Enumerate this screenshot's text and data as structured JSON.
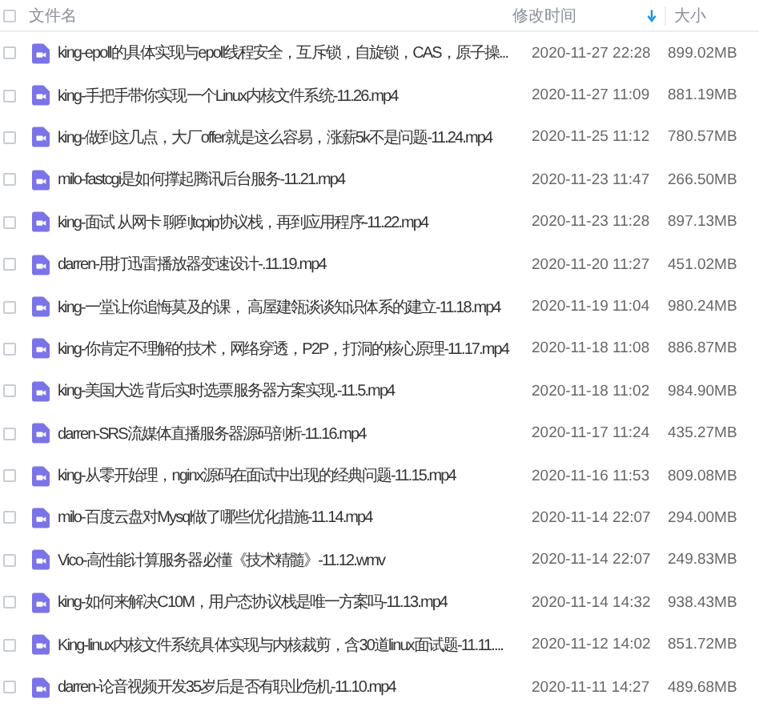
{
  "table": {
    "select_all": {
      "checked": false
    },
    "columns": [
      {
        "label": "文件名"
      },
      {
        "label": "修改时间",
        "sorted_descending": true
      },
      {
        "label": "大小"
      }
    ],
    "rows": [
      {
        "checked": false,
        "name": "king-epoll的具体实现与epoll线程安全，互斥锁，自旋锁，CAS，原子操...",
        "modified": "2020-11-27 22:28",
        "size": "899.02MB"
      },
      {
        "checked": false,
        "name": "king-手把手带你实现一个Linux内核文件系统-11.26.mp4",
        "modified": "2020-11-27 11:09",
        "size": "881.19MB"
      },
      {
        "checked": false,
        "name": "king-做到这几点，大厂offer就是这么容易，涨薪5k不是问题-11.24.mp4",
        "modified": "2020-11-25 11:12",
        "size": "780.57MB"
      },
      {
        "checked": false,
        "name": "milo-fastcgi是如何撑起腾讯后台服务-11.21.mp4",
        "modified": "2020-11-23 11:47",
        "size": "266.50MB"
      },
      {
        "checked": false,
        "name": "king-面试 从网卡 聊到tcpip协议栈，再到应用程序-11.22.mp4",
        "modified": "2020-11-23 11:28",
        "size": "897.13MB"
      },
      {
        "checked": false,
        "name": "darren-用打迅雷播放器变速设计-.11.19.mp4",
        "modified": "2020-11-20 11:27",
        "size": "451.02MB"
      },
      {
        "checked": false,
        "name": "king-一堂让你追悔莫及的课， 高屋建瓴谈谈知识体系的建立-11.18.mp4",
        "modified": "2020-11-19 11:04",
        "size": "980.24MB"
      },
      {
        "checked": false,
        "name": "king-你肯定不理解的技术，网络穿透，P2P，打洞的核心原理-11.17.mp4",
        "modified": "2020-11-18 11:08",
        "size": "886.87MB"
      },
      {
        "checked": false,
        "name": "king-美国大选 背后实时选票服务器方案实现.-11.5.mp4",
        "modified": "2020-11-18 11:02",
        "size": "984.90MB"
      },
      {
        "checked": false,
        "name": "darren-SRS流媒体直播服务器源码剖析-11.16.mp4",
        "modified": "2020-11-17 11:24",
        "size": "435.27MB"
      },
      {
        "checked": false,
        "name": "king-从零开始理，nginx源码在面试中出现的经典问题-11.15.mp4",
        "modified": "2020-11-16 11:53",
        "size": "809.08MB"
      },
      {
        "checked": false,
        "name": "milo-百度云盘对Mysql做了哪些优化措施-11.14.mp4",
        "modified": "2020-11-14 22:07",
        "size": "294.00MB"
      },
      {
        "checked": false,
        "name": "Vico-高性能计算服务器必懂《技术精髓》-11.12.wmv",
        "modified": "2020-11-14 22:07",
        "size": "249.83MB"
      },
      {
        "checked": false,
        "name": "king-如何来解决C10M，用户态协议栈是唯一方案吗-11.13.mp4",
        "modified": "2020-11-14 14:32",
        "size": "938.43MB"
      },
      {
        "checked": false,
        "name": "King-linux内核文件系统具体实现与内核裁剪，含30道linux面试题-11.11....",
        "modified": "2020-11-12 14:02",
        "size": "851.72MB"
      },
      {
        "checked": false,
        "name": "darren-论音视频开发35岁后是否有职业危机-11.10.mp4",
        "modified": "2020-11-11 14:27",
        "size": "489.68MB"
      }
    ]
  }
}
